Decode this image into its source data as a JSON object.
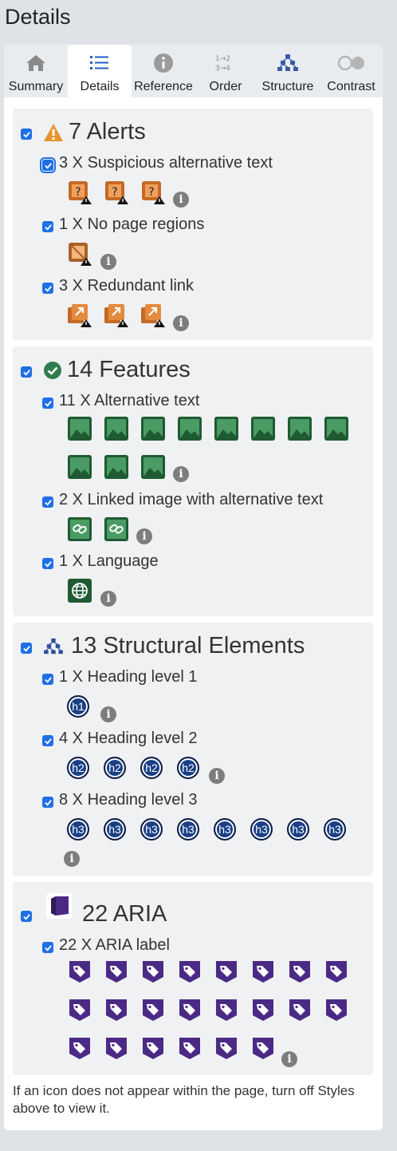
{
  "panel": {
    "title": "Details"
  },
  "tabs": [
    {
      "label": "Summary",
      "icon": "home-icon"
    },
    {
      "label": "Details",
      "icon": "list-icon"
    },
    {
      "label": "Reference",
      "icon": "info-icon"
    },
    {
      "label": "Order",
      "icon": "order-icon"
    },
    {
      "label": "Structure",
      "icon": "hierarchy-icon"
    },
    {
      "label": "Contrast",
      "icon": "contrast-icon"
    }
  ],
  "active_tab": "Details",
  "sections": {
    "alerts": {
      "title": "7 Alerts",
      "checked": true,
      "color": "#e8922d",
      "rows": [
        {
          "label": "3 X Suspicious alternative text",
          "icon": "suspicious-alt-icon",
          "count": 3,
          "checked": true
        },
        {
          "label": "1 X No page regions",
          "icon": "no-regions-icon",
          "count": 1,
          "checked": true
        },
        {
          "label": "3 X Redundant link",
          "icon": "redundant-link-icon",
          "count": 3,
          "checked": true
        }
      ]
    },
    "features": {
      "title": "14 Features",
      "checked": true,
      "color": "#2e7d4f",
      "rows": [
        {
          "label": "11 X Alternative text",
          "icon": "alt-text-image-icon",
          "count": 11,
          "checked": true
        },
        {
          "label": "2 X Linked image with alternative text",
          "icon": "linked-image-icon",
          "count": 2,
          "checked": true
        },
        {
          "label": "1 X Language",
          "icon": "globe-icon",
          "count": 1,
          "checked": true
        }
      ]
    },
    "structure": {
      "title": "13 Structural Elements",
      "checked": true,
      "color": "#1a3f86",
      "rows": [
        {
          "label": "1 X Heading level 1",
          "badge": "h1",
          "count": 1,
          "checked": true
        },
        {
          "label": "4 X Heading level 2",
          "badge": "h2",
          "count": 4,
          "checked": true
        },
        {
          "label": "8 X Heading level 3",
          "badge": "h3",
          "count": 8,
          "checked": true
        }
      ]
    },
    "aria": {
      "title": "22 ARIA",
      "checked": true,
      "color": "#4b2a86",
      "rows": [
        {
          "label": "22 X ARIA label",
          "icon": "aria-label-tag-icon",
          "count": 22,
          "checked": true
        }
      ]
    }
  },
  "footer": {
    "note": "If an icon does not appear within the page, turn off Styles above to view it."
  }
}
